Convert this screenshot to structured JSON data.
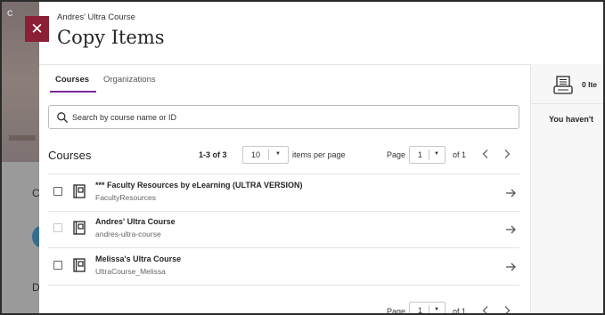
{
  "background": {
    "letters": [
      "C",
      "C",
      "D"
    ]
  },
  "modal": {
    "close_icon": "close-icon",
    "course_name": "Andres' Ultra Course",
    "title": "Copy Items"
  },
  "tabs": [
    {
      "label": "Courses",
      "active": true
    },
    {
      "label": "Organizations",
      "active": false
    }
  ],
  "selection": {
    "icon": "printer-icon",
    "count_label": "0 Ite",
    "empty_message": "You haven't"
  },
  "search": {
    "placeholder": "Search by course name or ID"
  },
  "list": {
    "title": "Courses",
    "range": "1-3 of 3",
    "per_page": "10",
    "items_per_page_label": "items per page",
    "page_label": "Page",
    "page_value": "1",
    "of_label": "of 1"
  },
  "courses": [
    {
      "title": "*** Faculty Resources by eLearning (ULTRA VERSION)",
      "id": "FacultyResources",
      "disabled": false
    },
    {
      "title": "Andres' Ultra Course",
      "id": "andres-ultra-course",
      "disabled": true
    },
    {
      "title": "Melissa's Ultra Course",
      "id": "UltraCourse_Melissa",
      "disabled": false
    }
  ],
  "colors": {
    "accent": "#8a1f36",
    "tab_underline": "#7b2a9c"
  }
}
